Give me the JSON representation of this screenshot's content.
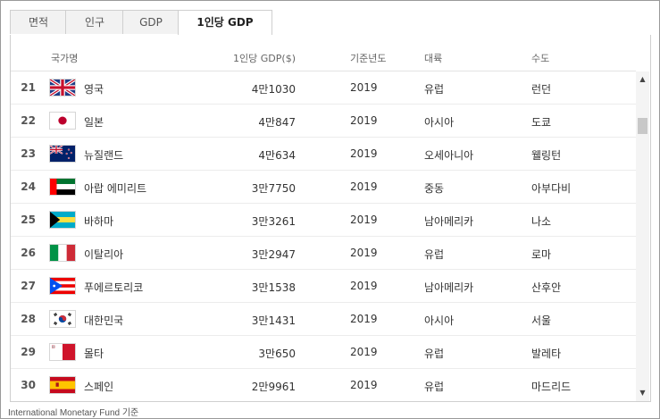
{
  "tabs": [
    {
      "label": "면적",
      "active": false
    },
    {
      "label": "인구",
      "active": false
    },
    {
      "label": "GDP",
      "active": false
    },
    {
      "label": "1인당 GDP",
      "active": true
    }
  ],
  "table": {
    "headers": {
      "country": "국가명",
      "gdp": "1인당 GDP($)",
      "year": "기준년도",
      "continent": "대륙",
      "capital": "수도"
    },
    "rows": [
      {
        "rank": "21",
        "country": "영국",
        "gdp": "4만1030",
        "year": "2019",
        "continent": "유럽",
        "capital": "런던",
        "flag": "uk-flag-icon"
      },
      {
        "rank": "22",
        "country": "일본",
        "gdp": "4만847",
        "year": "2019",
        "continent": "아시아",
        "capital": "도쿄",
        "flag": "japan-flag-icon"
      },
      {
        "rank": "23",
        "country": "뉴질랜드",
        "gdp": "4만634",
        "year": "2019",
        "continent": "오세아니아",
        "capital": "웰링턴",
        "flag": "new-zealand-flag-icon"
      },
      {
        "rank": "24",
        "country": "아랍 에미리트",
        "gdp": "3만7750",
        "year": "2019",
        "continent": "중동",
        "capital": "아부다비",
        "flag": "uae-flag-icon"
      },
      {
        "rank": "25",
        "country": "바하마",
        "gdp": "3만3261",
        "year": "2019",
        "continent": "남아메리카",
        "capital": "나소",
        "flag": "bahamas-flag-icon"
      },
      {
        "rank": "26",
        "country": "이탈리아",
        "gdp": "3만2947",
        "year": "2019",
        "continent": "유럽",
        "capital": "로마",
        "flag": "italy-flag-icon"
      },
      {
        "rank": "27",
        "country": "푸에르토리코",
        "gdp": "3만1538",
        "year": "2019",
        "continent": "남아메리카",
        "capital": "산후안",
        "flag": "puerto-rico-flag-icon"
      },
      {
        "rank": "28",
        "country": "대한민국",
        "gdp": "3만1431",
        "year": "2019",
        "continent": "아시아",
        "capital": "서울",
        "flag": "korea-flag-icon"
      },
      {
        "rank": "29",
        "country": "몰타",
        "gdp": "3만650",
        "year": "2019",
        "continent": "유럽",
        "capital": "발레타",
        "flag": "malta-flag-icon"
      },
      {
        "rank": "30",
        "country": "스페인",
        "gdp": "2만9961",
        "year": "2019",
        "continent": "유럽",
        "capital": "마드리드",
        "flag": "spain-flag-icon"
      }
    ]
  },
  "footer": "International Monetary Fund 기준",
  "scrollbar": {
    "up_icon": "scroll-up-arrow-icon",
    "down_icon": "scroll-down-arrow-icon"
  }
}
